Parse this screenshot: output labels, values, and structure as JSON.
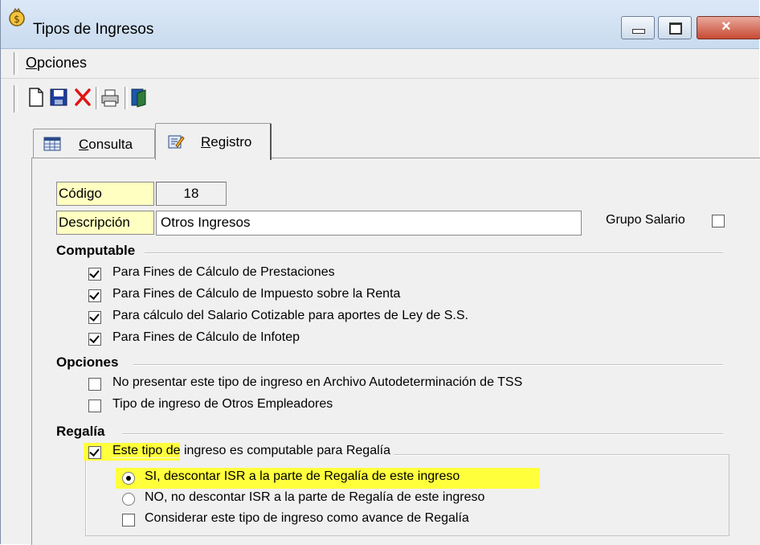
{
  "window": {
    "title": "Tipos de Ingresos",
    "close_glyph": "×",
    "icons": [
      "app-coin-icon",
      "minimize-icon",
      "maximize-icon",
      "close-icon"
    ]
  },
  "menu": {
    "opciones_first": "O",
    "opciones_rest": "pciones"
  },
  "toolbar": {
    "buttons": [
      "new-document-icon",
      "save-icon",
      "delete-icon",
      "print-icon",
      "exit-icon"
    ]
  },
  "tabs": {
    "consulta_first": "C",
    "consulta_rest": "onsulta",
    "registro_first": "R",
    "registro_rest": "egistro"
  },
  "form": {
    "codigo_label": "Código",
    "codigo_value": "18",
    "descripcion_label": "Descripción",
    "descripcion_value": "Otros Ingresos",
    "grupo_salario_label": "Grupo Salario"
  },
  "computable": {
    "title": "Computable",
    "items": [
      {
        "label": "Para Fines de Cálculo de Prestaciones",
        "checked": true
      },
      {
        "label": "Para Fines de Cálculo de Impuesto sobre la Renta",
        "checked": true
      },
      {
        "label": "Para cálculo del Salario Cotizable para aportes de Ley de S.S.",
        "checked": true
      },
      {
        "label": "Para Fines de Cálculo de Infotep",
        "checked": true
      }
    ]
  },
  "opciones": {
    "title": "Opciones",
    "items": [
      {
        "label": "No presentar este tipo de ingreso en Archivo Autodeterminación de TSS",
        "checked": false
      },
      {
        "label": "Tipo de ingreso de Otros Empleadores",
        "checked": false
      }
    ]
  },
  "regalia": {
    "title": "Regalía",
    "computable_label": "Este tipo de ingreso es computable para Regalía",
    "radio_si": "SI, descontar ISR a la parte de Regalía de este ingreso",
    "radio_no": "NO, no descontar ISR a la parte de Regalía de este ingreso",
    "avance_label": "Considerar este tipo de ingreso como avance de Regalía"
  },
  "colors": {
    "highlight": "#ffff3c",
    "label_bg": "#ffffc1",
    "window_bg": "#f0f0f0"
  }
}
